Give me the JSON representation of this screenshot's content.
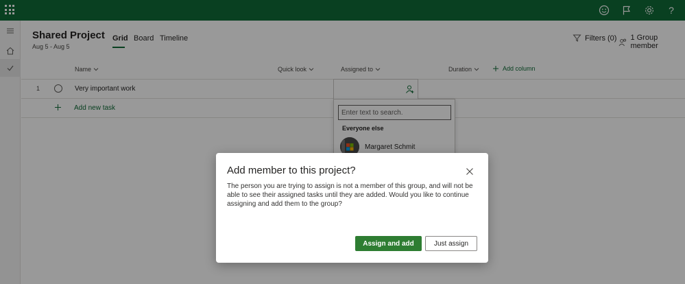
{
  "colors": {
    "topbar": "#0f6b37",
    "accent": "#0f6b37",
    "primary_button": "#2e7d32"
  },
  "topbar": {
    "app_launcher_icon": "waffle-icon",
    "icons": [
      "smiley-icon",
      "flag-icon",
      "gear-icon",
      "help-icon"
    ],
    "help_glyph": "?"
  },
  "rail": {
    "items": [
      "hamburger-icon",
      "home-icon",
      "check-icon"
    ]
  },
  "header": {
    "title": "Shared Project",
    "dates": "Aug 5 - Aug 5",
    "tabs": [
      {
        "label": "Grid",
        "active": true
      },
      {
        "label": "Board",
        "active": false
      },
      {
        "label": "Timeline",
        "active": false
      }
    ],
    "filters_label": "Filters (0)",
    "members_label": "1 Group member"
  },
  "grid": {
    "columns": [
      "Name",
      "Quick look",
      "Assigned to",
      "Duration"
    ],
    "add_column_label": "Add column",
    "rows": [
      {
        "number": "1",
        "name": "Very important work"
      }
    ],
    "add_task_label": "Add new task"
  },
  "assign_dropdown": {
    "search_placeholder": "Enter text to search.",
    "section_label": "Everyone else",
    "person_name": "Margaret Schmit"
  },
  "dialog": {
    "title": "Add member to this project?",
    "body": "The person you are trying to assign is not a member of this group, and will not be able to see their assigned tasks until they are added. Would you like to continue assigning and add them to the group?",
    "primary_label": "Assign and add",
    "secondary_label": "Just assign"
  }
}
